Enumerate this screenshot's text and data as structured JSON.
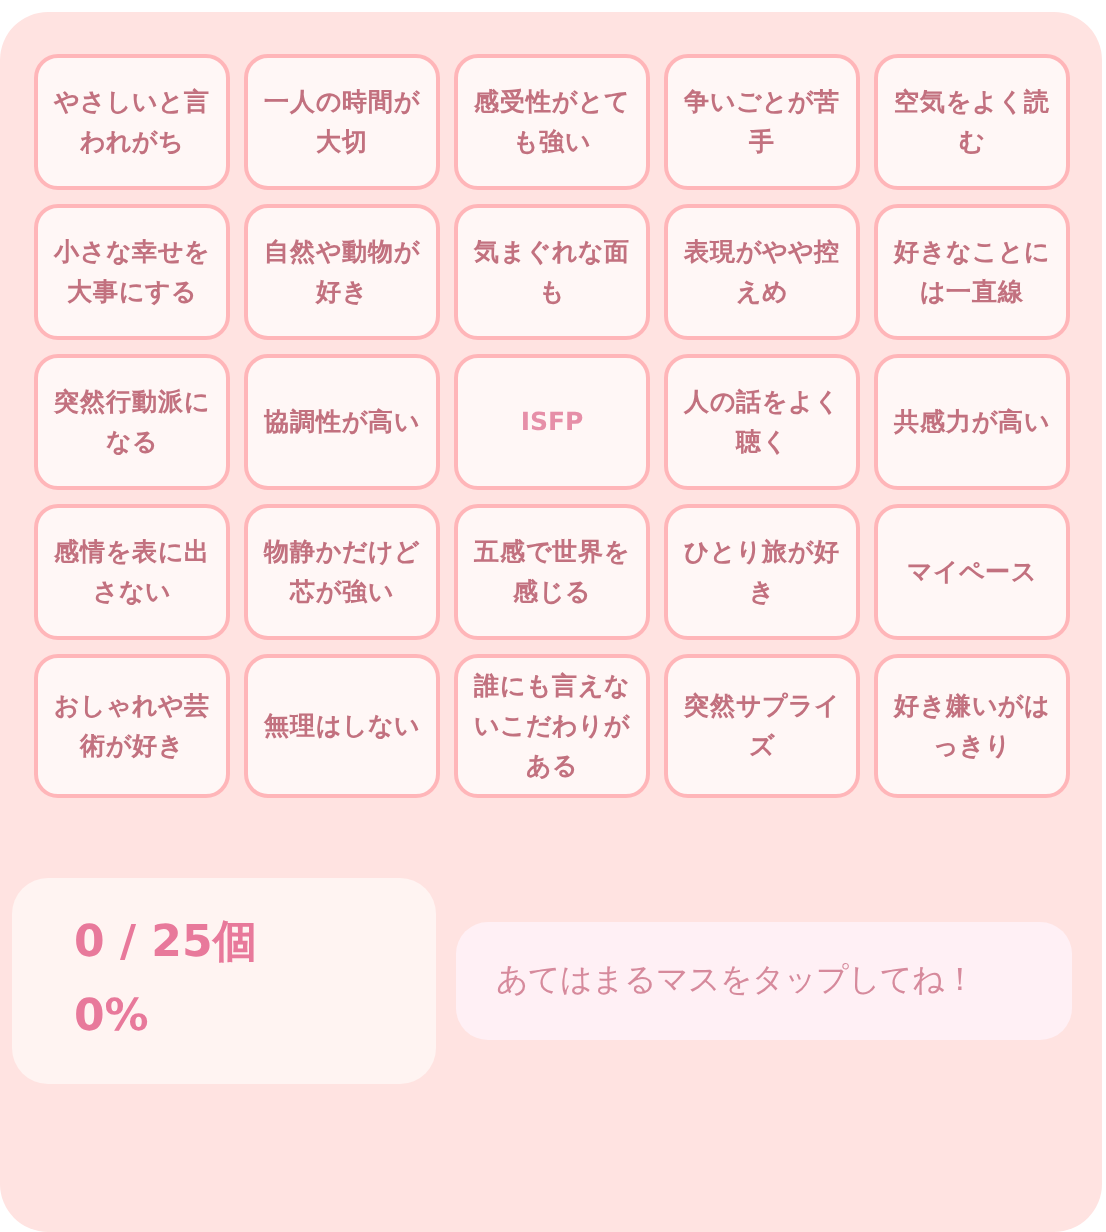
{
  "bingo_cells": [
    {
      "label": "やさしいと言われがち",
      "kind": "normal",
      "selected": false
    },
    {
      "label": "一人の時間が大切",
      "kind": "normal",
      "selected": false
    },
    {
      "label": "感受性がとても強い",
      "kind": "normal",
      "selected": false
    },
    {
      "label": "争いごとが苦手",
      "kind": "normal",
      "selected": false
    },
    {
      "label": "空気をよく読む",
      "kind": "normal",
      "selected": false
    },
    {
      "label": "小さな幸せを大事にする",
      "kind": "normal",
      "selected": false
    },
    {
      "label": "自然や動物が好き",
      "kind": "normal",
      "selected": false
    },
    {
      "label": "気まぐれな面も",
      "kind": "normal",
      "selected": false
    },
    {
      "label": "表現がやや控えめ",
      "kind": "normal",
      "selected": false
    },
    {
      "label": "好きなことには一直線",
      "kind": "normal",
      "selected": false
    },
    {
      "label": "突然行動派になる",
      "kind": "normal",
      "selected": false
    },
    {
      "label": "協調性が高い",
      "kind": "normal",
      "selected": false
    },
    {
      "label": "ISFP",
      "kind": "center",
      "selected": false
    },
    {
      "label": "人の話をよく聴く",
      "kind": "normal",
      "selected": false
    },
    {
      "label": "共感力が高い",
      "kind": "normal",
      "selected": false
    },
    {
      "label": "感情を表に出さない",
      "kind": "normal",
      "selected": false
    },
    {
      "label": "物静かだけど芯が強い",
      "kind": "normal",
      "selected": false
    },
    {
      "label": "五感で世界を感じる",
      "kind": "normal",
      "selected": false
    },
    {
      "label": "ひとり旅が好き",
      "kind": "normal",
      "selected": false
    },
    {
      "label": "マイペース",
      "kind": "normal",
      "selected": false
    },
    {
      "label": "おしゃれや芸術が好き",
      "kind": "normal",
      "selected": false
    },
    {
      "label": "無理はしない",
      "kind": "normal",
      "selected": false
    },
    {
      "label": "誰にも言えないこだわりがある",
      "kind": "normal",
      "selected": false
    },
    {
      "label": "突然サプライズ",
      "kind": "normal",
      "selected": false
    },
    {
      "label": "好き嫌いがはっきり",
      "kind": "normal",
      "selected": false
    }
  ],
  "score": {
    "count": "0 / 25個",
    "percent": "0%"
  },
  "message": "あてはまるマスをタップしてね！"
}
